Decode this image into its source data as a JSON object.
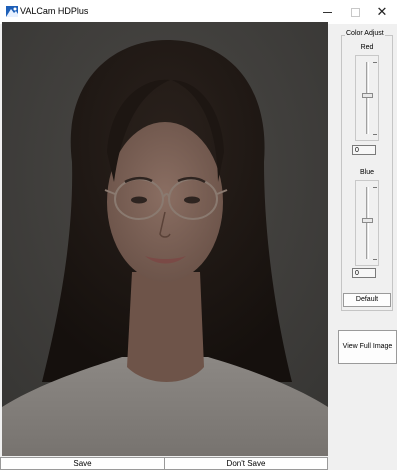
{
  "window": {
    "title": "VALCam HDPlus",
    "icon": "valcam-app-icon",
    "controls": {
      "minimize_icon": "minimize-icon",
      "maximize_icon": "maximize-icon",
      "close_glyph": "✕"
    }
  },
  "photo": {
    "description_icon": "portrait-photo"
  },
  "color_adjust": {
    "group_label": "Color Adjust",
    "red": {
      "label": "Red",
      "value": "0",
      "slider_position": 0.45
    },
    "blue": {
      "label": "Blue",
      "value": "0",
      "slider_position": 0.45
    },
    "default_button": "Default"
  },
  "view_full_image_button": "View Full Image",
  "bottom_buttons": {
    "save": "Save",
    "dont_save": "Don't Save"
  },
  "colors": {
    "window_bg": "#f0f0f0",
    "titlebar_bg": "#ffffff",
    "photo_overlay": "#3d3c3a"
  }
}
